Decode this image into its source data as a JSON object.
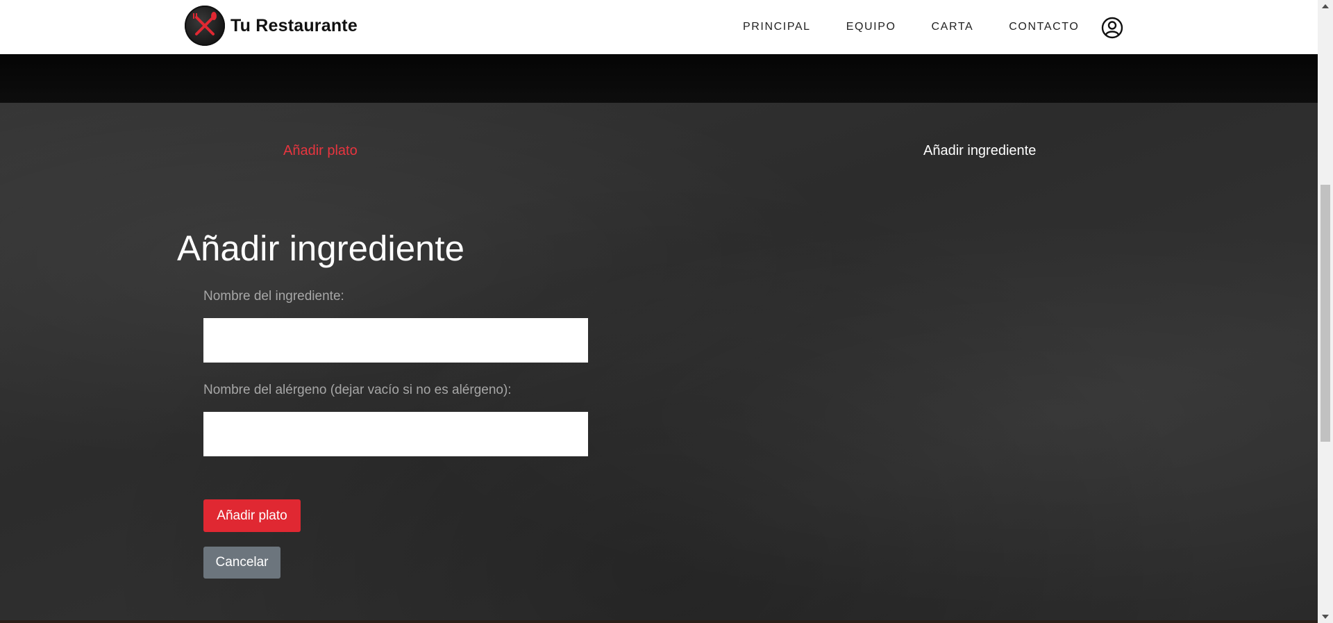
{
  "header": {
    "brand_name": "Tu Restaurante",
    "logo_icon": "crossed-fork-knife-icon",
    "nav": [
      {
        "label": "PRINCIPAL"
      },
      {
        "label": "EQUIPO"
      },
      {
        "label": "CARTA"
      },
      {
        "label": "CONTACTO"
      }
    ],
    "user_icon": "user-circle-icon"
  },
  "tabs": {
    "add_dish": "Añadir plato",
    "add_ingredient": "Añadir ingrediente"
  },
  "form": {
    "title": "Añadir ingrediente",
    "ingredient_name_label": "Nombre del ingrediente:",
    "ingredient_name_value": "",
    "allergen_label": "Nombre del alérgeno (dejar vacío si no es alérgeno):",
    "allergen_value": "",
    "submit_label": "Añadir plato",
    "cancel_label": "Cancelar"
  },
  "colors": {
    "accent_red": "#e02832",
    "active_tab": "#e8353f",
    "cancel_gray": "#6c757d",
    "label_gray": "#a7a7a7"
  }
}
